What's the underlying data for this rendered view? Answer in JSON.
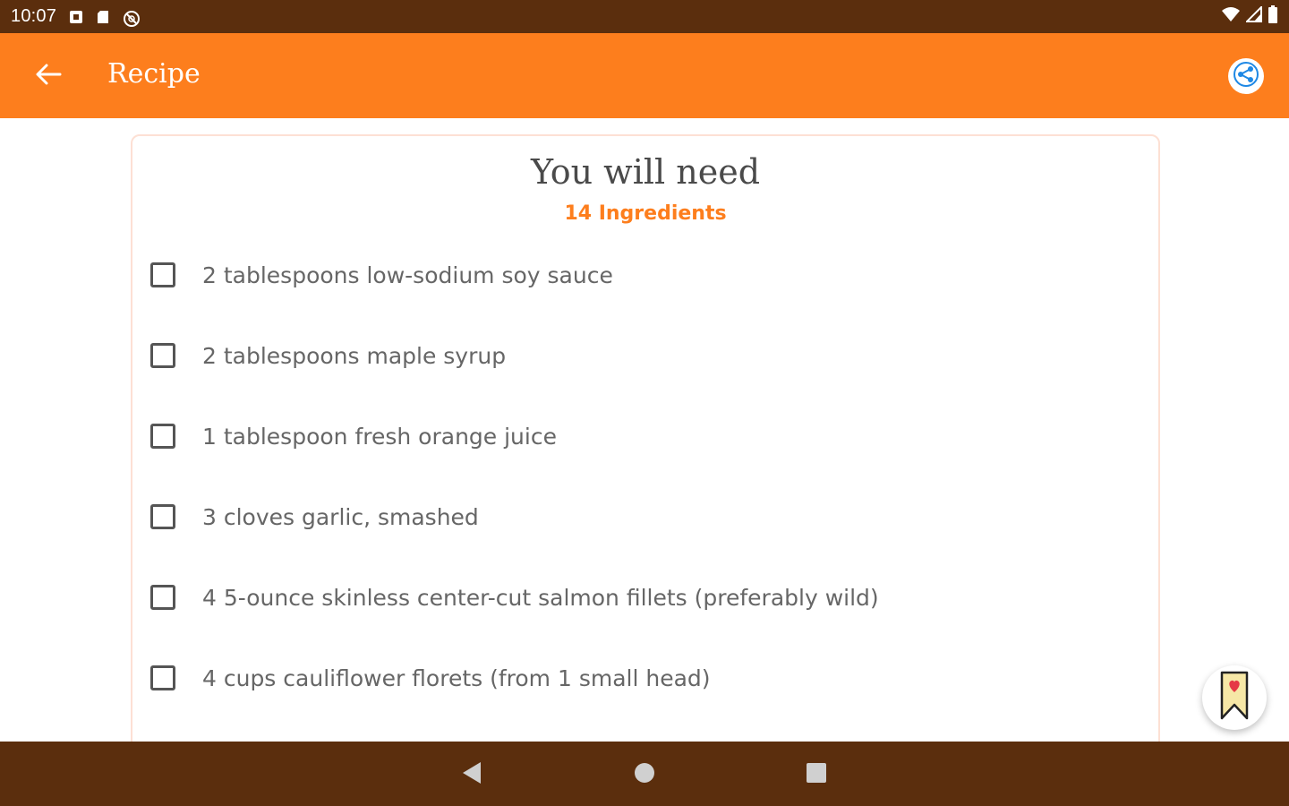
{
  "status_bar": {
    "time": "10:07",
    "left_icons": [
      "notification-square-icon",
      "sd-card-icon",
      "blocked-circle-icon"
    ],
    "right_icons": [
      "wifi-icon",
      "cell-signal-icon",
      "battery-icon"
    ]
  },
  "app_bar": {
    "title": "Recipe",
    "back_icon": "arrow-left-icon",
    "share_icon": "share-icon",
    "color": "#fd7e1d"
  },
  "ingredients_card": {
    "title": "You will need",
    "count_label": "14 Ingredients",
    "items": [
      {
        "text": "2 tablespoons low-sodium soy sauce",
        "checked": false
      },
      {
        "text": "2 tablespoons maple syrup",
        "checked": false
      },
      {
        "text": "1 tablespoon fresh orange juice",
        "checked": false
      },
      {
        "text": "3 cloves garlic, smashed",
        "checked": false
      },
      {
        "text": "4 5-ounce skinless center-cut salmon fillets (preferably wild)",
        "checked": false
      },
      {
        "text": "4 cups cauliflower florets (from 1 small head)",
        "checked": false
      }
    ]
  },
  "fab": {
    "icon": "bookmark-heart-icon"
  },
  "nav_bar": {
    "icons": [
      "back-triangle-icon",
      "home-circle-icon",
      "recents-square-icon"
    ],
    "color": "#5b2e0d"
  }
}
